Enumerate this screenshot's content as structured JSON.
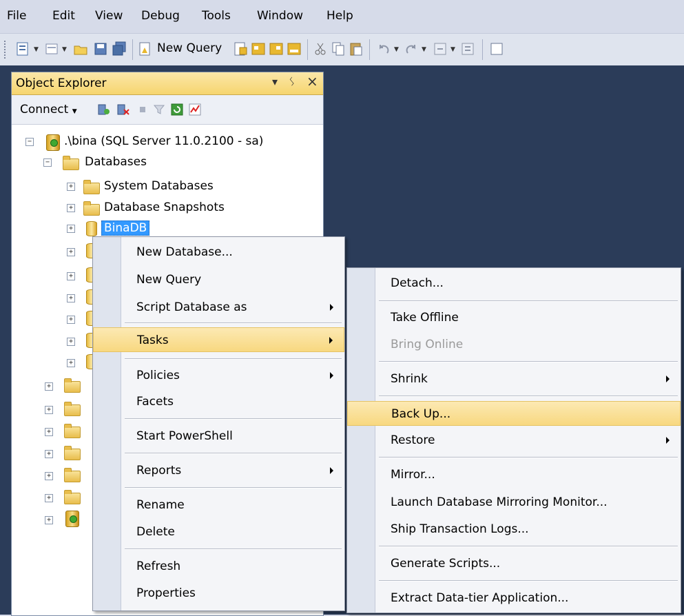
{
  "menubar": [
    "File",
    "Edit",
    "View",
    "Debug",
    "Tools",
    "Window",
    "Help"
  ],
  "toolbar": {
    "new_query": "New Query"
  },
  "object_explorer": {
    "title": "Object Explorer",
    "title_controls": {
      "dropdown": "▾",
      "pin": "ᛊ",
      "close": "×"
    },
    "connect_label": "Connect",
    "server_node": ".\\bina (SQL Server 11.0.2100 - sa)",
    "databases_node": "Databases",
    "system_databases": "System Databases",
    "database_snapshots": "Database Snapshots",
    "selected_db": "BinaDB"
  },
  "context_menu": {
    "items": [
      "New Database...",
      "New Query",
      "Script Database as",
      "Tasks",
      "Policies",
      "Facets",
      "Start PowerShell",
      "Reports",
      "Rename",
      "Delete",
      "Refresh",
      "Properties"
    ]
  },
  "tasks_menu": {
    "items": [
      "Detach...",
      "Take Offline",
      "Bring Online",
      "Shrink",
      "Back Up...",
      "Restore",
      "Mirror...",
      "Launch Database Mirroring Monitor...",
      "Ship Transaction Logs...",
      "Generate Scripts...",
      "Extract Data-tier Application..."
    ]
  },
  "colors": {
    "workspace": "#2b3c59",
    "highlight": "#f8d880",
    "selection": "#3399ff"
  }
}
